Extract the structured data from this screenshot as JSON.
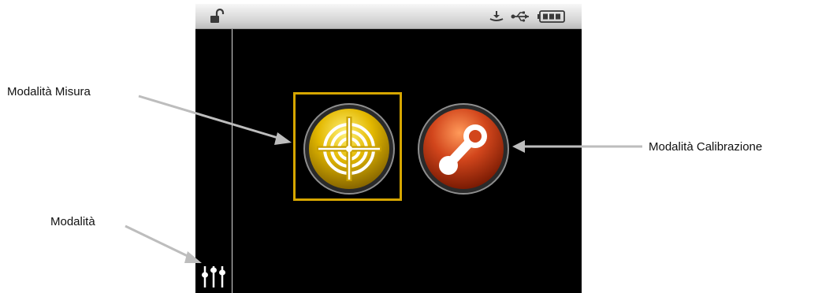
{
  "callouts": {
    "measure_mode": "Modalità Misura",
    "calibration_mode": "Modalità Calibrazione",
    "mode": "Modalità"
  },
  "status_bar": {
    "icons": [
      "lock-open-icon",
      "download-icon",
      "usb-icon",
      "battery-icon"
    ],
    "battery_level": 1.0
  },
  "modes": [
    {
      "name": "measure",
      "icon": "target-icon",
      "color": "#d9b000",
      "selected": true
    },
    {
      "name": "calibration",
      "icon": "calibration-icon",
      "color": "#d2461c",
      "selected": false
    }
  ],
  "sidebar": {
    "icon": "sliders-icon"
  },
  "colors": {
    "screen_background": "#000000",
    "selection_frame": "#d6a600",
    "arrow": "#bdbdbd"
  }
}
